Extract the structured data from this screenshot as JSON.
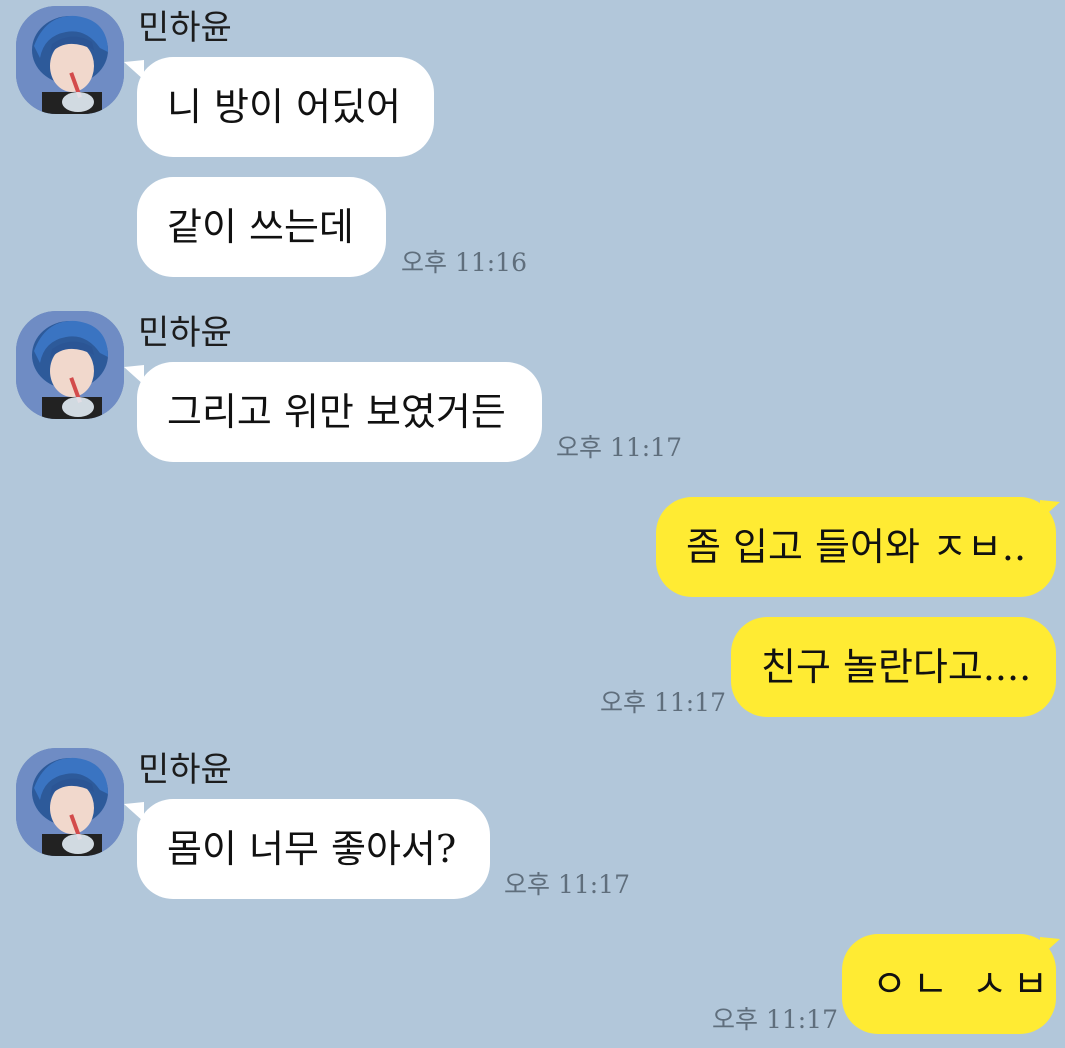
{
  "chat": {
    "sender_name": "민하윤",
    "colors": {
      "background": "#b2c7da",
      "incoming_bubble": "#ffffff",
      "outgoing_bubble": "#ffeb33"
    },
    "messages": [
      {
        "direction": "in",
        "text": "니 방이 어딨어"
      },
      {
        "direction": "in",
        "text": "같이 쓰는데",
        "time": "오후 11:16"
      },
      {
        "direction": "in",
        "text": "그리고 위만 보였거든",
        "time": "오후 11:17"
      },
      {
        "direction": "out",
        "text": "좀 입고 들어와 ㅈㅂ.."
      },
      {
        "direction": "out",
        "text": "친구 놀란다고....",
        "time": "오후 11:17"
      },
      {
        "direction": "in",
        "text": "몸이 너무 좋아서?",
        "time": "오후 11:17"
      },
      {
        "direction": "out",
        "text": "ㅇㄴ ㅅㅂ",
        "time": "오후 11:17"
      }
    ]
  }
}
